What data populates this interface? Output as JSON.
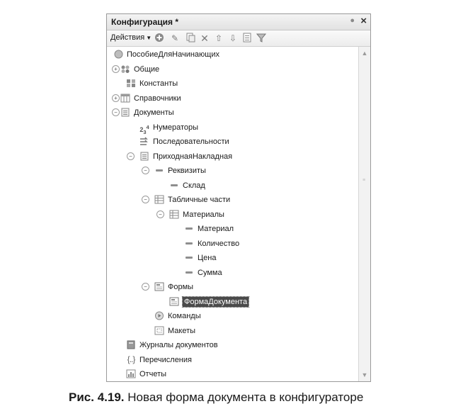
{
  "window": {
    "title": "Конфигурация *",
    "pin_icon": "pin-icon",
    "close_label": "×"
  },
  "toolbar": {
    "actions_label": "Действия",
    "buttons": [
      "add-icon",
      "edit-icon",
      "copy-icon",
      "delete-icon",
      "move-up-icon",
      "move-down-icon",
      "list-icon",
      "filter-icon"
    ]
  },
  "tree": {
    "items": [
      {
        "label": "ПособиеДляНачинающих",
        "level": 0,
        "expander": "",
        "icon": "root-config-icon"
      },
      {
        "label": "Общие",
        "level": 0,
        "expander": "+",
        "icon": "common-icon"
      },
      {
        "label": "Константы",
        "level": 0,
        "expander": "",
        "icon": "constants-icon"
      },
      {
        "label": "Справочники",
        "level": 0,
        "expander": "+",
        "icon": "catalogs-icon"
      },
      {
        "label": "Документы",
        "level": 0,
        "expander": "−",
        "icon": "documents-icon"
      },
      {
        "label": "Нумераторы",
        "level": 1,
        "expander": "",
        "icon": "numerators-icon"
      },
      {
        "label": "Последовательности",
        "level": 1,
        "expander": "",
        "icon": "sequences-icon"
      },
      {
        "label": "ПриходнаяНакладная",
        "level": 1,
        "expander": "−",
        "icon": "document-icon"
      },
      {
        "label": "Реквизиты",
        "level": 2,
        "expander": "−",
        "icon": "attributes-icon"
      },
      {
        "label": "Склад",
        "level": 3,
        "expander": "",
        "icon": "attribute-icon"
      },
      {
        "label": "Табличные части",
        "level": 2,
        "expander": "−",
        "icon": "tabular-sections-icon"
      },
      {
        "label": "Материалы",
        "level": 3,
        "expander": "−",
        "icon": "tabular-section-icon"
      },
      {
        "label": "Материал",
        "level": 4,
        "expander": "",
        "icon": "attribute-icon"
      },
      {
        "label": "Количество",
        "level": 4,
        "expander": "",
        "icon": "attribute-icon"
      },
      {
        "label": "Цена",
        "level": 4,
        "expander": "",
        "icon": "attribute-icon"
      },
      {
        "label": "Сумма",
        "level": 4,
        "expander": "",
        "icon": "attribute-icon"
      },
      {
        "label": "Формы",
        "level": 2,
        "expander": "−",
        "icon": "forms-icon"
      },
      {
        "label": "ФормаДокумента",
        "level": 3,
        "expander": "",
        "icon": "form-icon",
        "selected": true
      },
      {
        "label": "Команды",
        "level": 2,
        "expander": "",
        "icon": "commands-icon"
      },
      {
        "label": "Макеты",
        "level": 2,
        "expander": "",
        "icon": "templates-icon"
      },
      {
        "label": "Журналы документов",
        "level": 0,
        "expander": "",
        "icon": "journals-icon"
      },
      {
        "label": "Перечисления",
        "level": 0,
        "expander": "",
        "icon": "enums-icon"
      },
      {
        "label": "Отчеты",
        "level": 0,
        "expander": "",
        "icon": "reports-icon"
      }
    ]
  },
  "caption": {
    "number": "Рис. 4.19.",
    "text": "Новая форма документа в конфигураторе"
  },
  "colors": {
    "selection": "#4a4a4a",
    "icon": "#6e6e6e"
  }
}
